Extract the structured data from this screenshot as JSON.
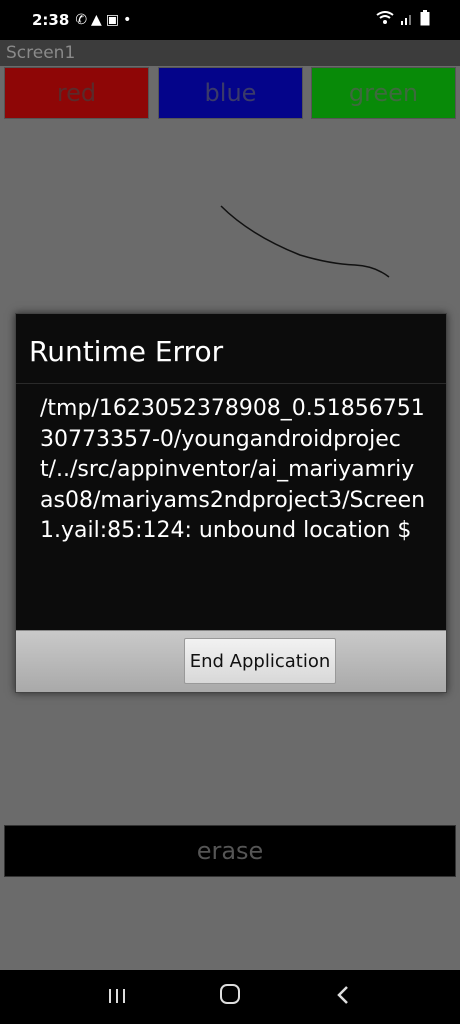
{
  "status_bar": {
    "time": "2:38",
    "icons": [
      "whatsapp-icon",
      "warning-icon",
      "teams-icon",
      "dot-icon"
    ],
    "right_icons": [
      "wifi-icon",
      "signal-icon",
      "battery-icon"
    ]
  },
  "screen": {
    "title": "Screen1"
  },
  "buttons": {
    "red_label": "red",
    "blue_label": "blue",
    "green_label": "green",
    "erase_label": "erase"
  },
  "dialog": {
    "title": "Runtime Error",
    "message": "/tmp/1623052378908_0.5185675130773357-0/youngandroidproject/../src/appinventor/ai_mariyamriyas08/mariyams2ndproject3/Screen1.yail:85:124: unbound location $",
    "button_label": "End Application"
  },
  "colors": {
    "red": "#8e0606",
    "blue": "#04048a",
    "green": "#088a08",
    "background": "#6b6b6b"
  },
  "nav": {
    "icons": [
      "recents-icon",
      "home-icon",
      "back-icon"
    ]
  }
}
